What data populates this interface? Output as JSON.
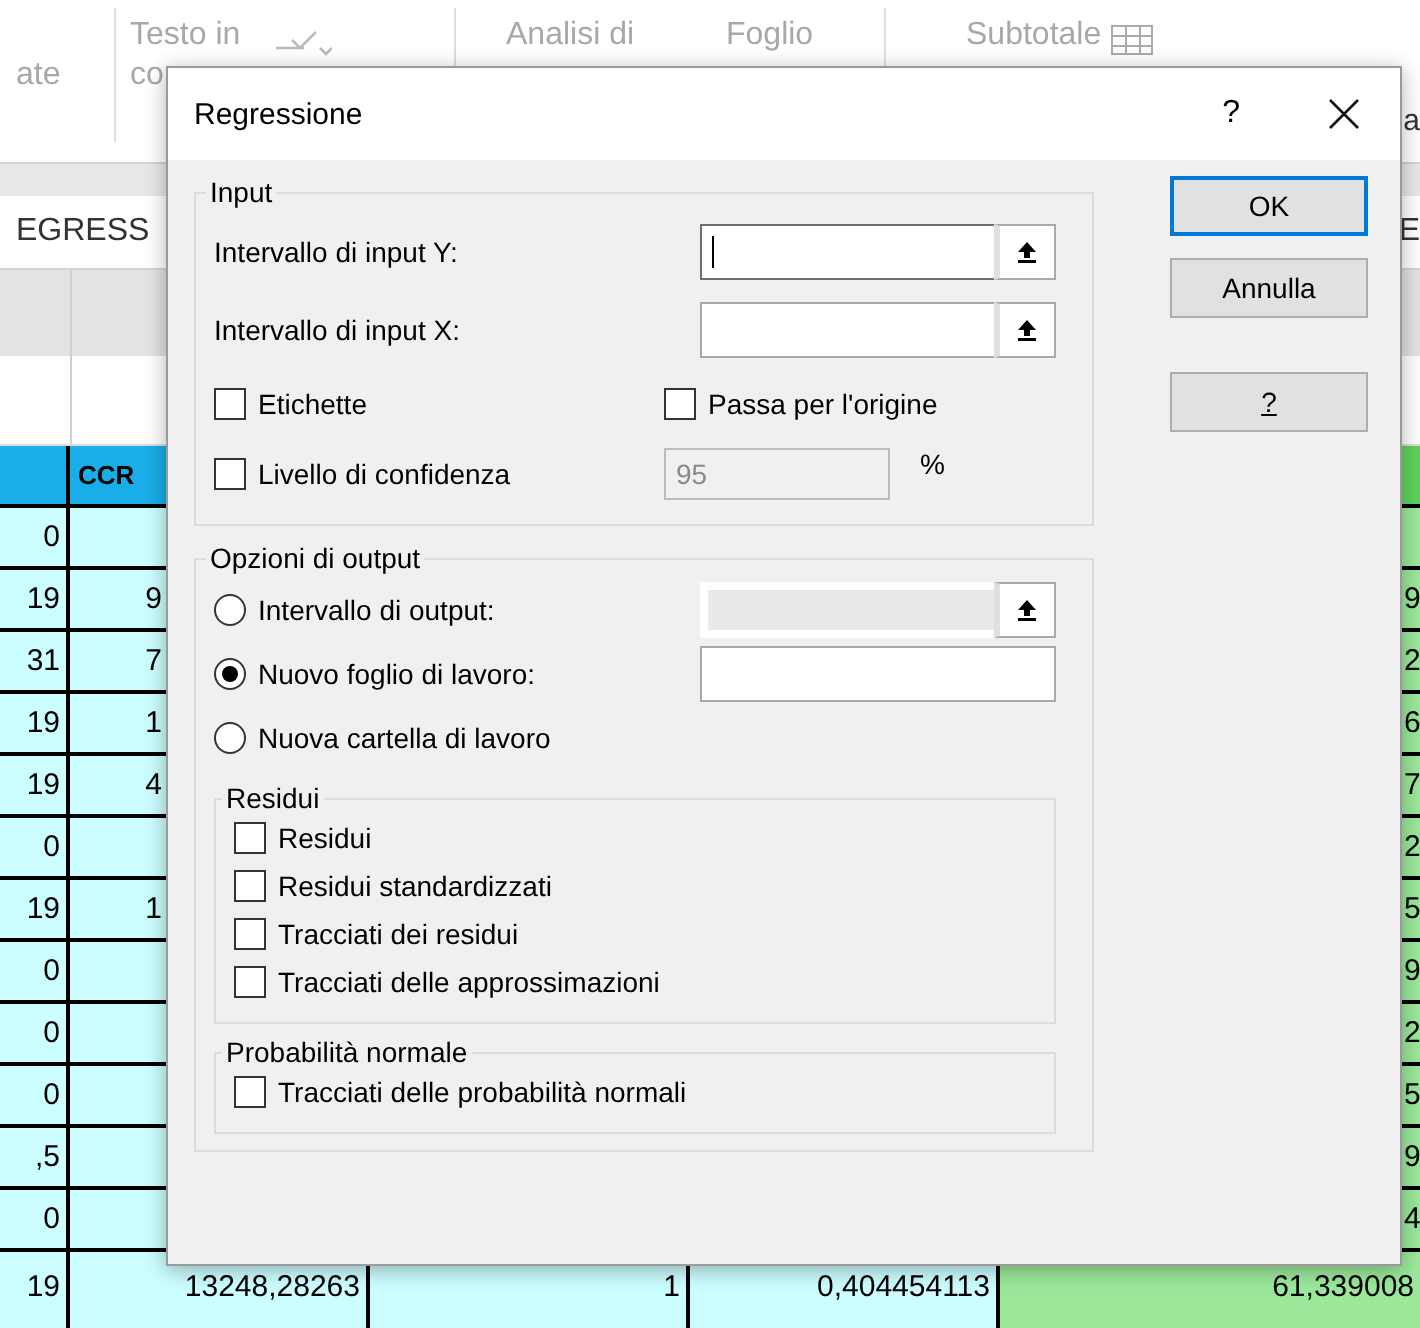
{
  "ribbon": {
    "groups": [
      {
        "items": [
          "ate"
        ]
      },
      {
        "items": [
          "Testo in",
          "co"
        ]
      },
      {
        "items": [
          "Analisi di"
        ]
      },
      {
        "items": [
          "Foglio"
        ]
      },
      {
        "items": [
          "Subtotale"
        ]
      }
    ],
    "edge_fragment": "a"
  },
  "formula_row": {
    "name_box": "EGRESS",
    "edge_fragment": "E"
  },
  "sheet": {
    "header_label": "CCR",
    "rows": [
      {
        "kind": "partial",
        "cells": [
          "0",
          "",
          "",
          "",
          ""
        ]
      },
      {
        "kind": "partial",
        "cells": [
          "19",
          "9",
          "",
          "",
          "9"
        ]
      },
      {
        "kind": "partial",
        "cells": [
          "31",
          "7",
          "",
          "",
          "2"
        ]
      },
      {
        "kind": "partial",
        "cells": [
          "19",
          "1",
          "",
          "",
          "6"
        ]
      },
      {
        "kind": "partial",
        "cells": [
          "19",
          "4",
          "",
          "",
          "7"
        ]
      },
      {
        "kind": "partial",
        "cells": [
          "0",
          "",
          "",
          "",
          "2"
        ]
      },
      {
        "kind": "partial",
        "cells": [
          "19",
          "1",
          "",
          "",
          "5"
        ]
      },
      {
        "kind": "partial",
        "cells": [
          "0",
          "",
          "",
          "",
          "9"
        ]
      },
      {
        "kind": "partial",
        "cells": [
          "0",
          "",
          "",
          "",
          "2"
        ]
      },
      {
        "kind": "partial",
        "cells": [
          "0",
          "",
          "",
          "",
          "5"
        ]
      },
      {
        "kind": "partial",
        "cells": [
          ",5",
          "",
          "",
          "",
          "9"
        ]
      },
      {
        "kind": "partial",
        "cells": [
          "0",
          "",
          "",
          "",
          "4"
        ]
      },
      {
        "kind": "full",
        "cells": [
          "19",
          "13248,28263",
          "1",
          "0,404454113",
          "61,339008"
        ]
      }
    ]
  },
  "dialog": {
    "title": "Regressione",
    "help": "?",
    "input_group": {
      "label": "Input",
      "ranges": [
        {
          "label": "Intervallo di input Y:",
          "focused": true
        },
        {
          "label": "Intervallo di input X:",
          "focused": false
        }
      ],
      "options": [
        {
          "label": "Etichette",
          "checked": false
        },
        {
          "label": "Passa per l'origine",
          "checked": false
        }
      ],
      "confidence": {
        "label": "Livello di confidenza",
        "checked": false,
        "value": "95",
        "disabled": true,
        "unit": "%"
      }
    },
    "output_group": {
      "label": "Opzioni di output",
      "choices": [
        {
          "label": "Intervallo di output:",
          "selected": false,
          "kind": "range",
          "disabled": true
        },
        {
          "label": "Nuovo foglio di lavoro:",
          "selected": true,
          "kind": "text"
        },
        {
          "label": "Nuova cartella di lavoro",
          "selected": false,
          "kind": "plain"
        }
      ],
      "subgroups": [
        {
          "label": "Residui",
          "options": [
            {
              "label": "Residui",
              "checked": false
            },
            {
              "label": "Residui standardizzati",
              "checked": false
            },
            {
              "label": "Tracciati dei residui",
              "checked": false
            },
            {
              "label": "Tracciati delle approssimazioni",
              "checked": false
            }
          ]
        },
        {
          "label": "Probabilità normale",
          "options": [
            {
              "label": "Tracciati delle probabilità normali",
              "checked": false
            }
          ]
        }
      ]
    },
    "buttons": [
      {
        "label": "OK",
        "default": true
      },
      {
        "label": "Annulla",
        "default": false
      },
      {
        "label": "?",
        "default": false
      }
    ]
  }
}
